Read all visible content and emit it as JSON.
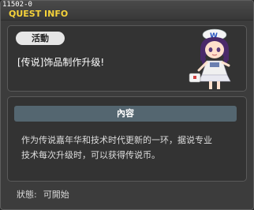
{
  "window": {
    "quest_id": "11502-0",
    "title": "QUEST INFO"
  },
  "quest": {
    "category": "活動",
    "name": "[传说]饰品制作升级!"
  },
  "content": {
    "header": "內容",
    "line1": "作为传说嘉年华和技术时代更新的一环，据说专业",
    "line2": "技术每次升级时，可以获得传说币。"
  },
  "status": {
    "label": "狀態:",
    "value": "可開始"
  },
  "colors": {
    "title": "#f5d23a",
    "content_header": "#546670"
  },
  "icons": [
    "npc-maid-portrait"
  ]
}
